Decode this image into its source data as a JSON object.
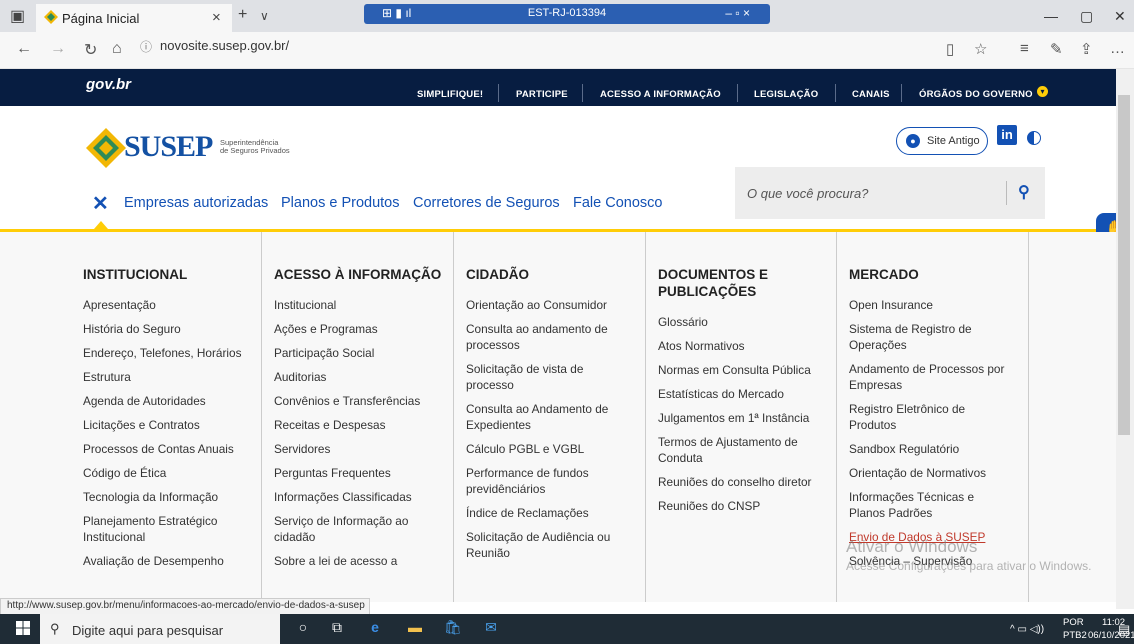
{
  "browser": {
    "tab_title": "Página Inicial",
    "url": "novosite.susep.gov.br/",
    "remote_title": "EST-RJ-013394",
    "status_url": "http://www.susep.gov.br/menu/informacoes-ao-mercado/envio-de-dados-a-susep"
  },
  "gov_bar": {
    "logo": "gov.br",
    "links": [
      "SIMPLIFIQUE!",
      "PARTICIPE",
      "ACESSO A INFORMAÇÃO",
      "LEGISLAÇÃO",
      "CANAIS",
      "ÓRGÃOS DO GOVERNO"
    ]
  },
  "header": {
    "brand": "SUSEP",
    "brand_sub_line1": "Superintendência",
    "brand_sub_line2": "de Seguros Privados",
    "site_antigo": "Site Antigo",
    "linkedin": "in"
  },
  "main_nav": {
    "items": [
      "Empresas autorizadas",
      "Planos e Produtos",
      "Corretores de Seguros",
      "Fale Conosco"
    ],
    "search_placeholder": "O que você procura?"
  },
  "menu": {
    "col1": {
      "title": "INSTITUCIONAL",
      "items": [
        "Apresentação",
        "História do Seguro",
        "Endereço, Telefones, Horários",
        "Estrutura",
        "Agenda de Autoridades",
        "Licitações e Contratos",
        "Processos de Contas Anuais",
        "Código de Ética",
        "Tecnologia da Informação",
        "Planejamento Estratégico Institucional",
        "Avaliação de Desempenho"
      ]
    },
    "col2": {
      "title": "ACESSO À INFORMAÇÃO",
      "items": [
        "Institucional",
        "Ações e Programas",
        "Participação Social",
        "Auditorias",
        "Convênios e Transferências",
        "Receitas e Despesas",
        "Servidores",
        "Perguntas Frequentes",
        "Informações Classificadas",
        "Serviço de Informação ao cidadão",
        "Sobre a lei de acesso a"
      ]
    },
    "col3": {
      "title": "CIDADÃO",
      "items": [
        "Orientação ao Consumidor",
        "Consulta ao andamento de processos",
        "Solicitação de vista de processo",
        "Consulta ao Andamento de Expedientes",
        "Cálculo PGBL e VGBL",
        "Performance de fundos previdênciários",
        "Índice de Reclamações",
        "Solicitação de Audiência ou Reunião"
      ]
    },
    "col4": {
      "title": "DOCUMENTOS E PUBLICAÇÕES",
      "items": [
        "Glossário",
        "Atos Normativos",
        "Normas em Consulta Pública",
        "Estatísticas do Mercado",
        "Julgamentos em 1ª Instância",
        "Termos de Ajustamento de Conduta",
        "Reuniões do conselho diretor",
        "Reuniões do CNSP"
      ]
    },
    "col5": {
      "title": "MERCADO",
      "items": [
        "Open Insurance",
        "Sistema de Registro de Operações",
        "Andamento de Processos por Empresas",
        "Registro Eletrônico de Produtos",
        "Sandbox Regulatório",
        "Orientação de Normativos",
        "Informações Técnicas e Planos Padrões",
        "Envio de Dados à SUSEP",
        "Solvência – Supervisão"
      ]
    }
  },
  "watermark": {
    "line1": "Ativar o Windows",
    "line2": "Acesse Configurações para ativar o Windows."
  },
  "taskbar": {
    "search_placeholder": "Digite aqui para pesquisar",
    "lang1": "POR",
    "lang2": "PTB2",
    "time": "11:02",
    "date": "06/10/2021"
  }
}
